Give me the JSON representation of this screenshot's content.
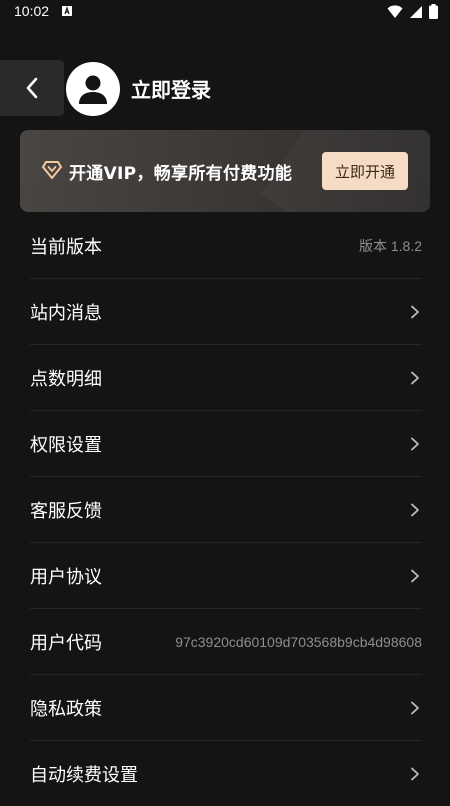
{
  "status_bar": {
    "time": "10:02",
    "icons": [
      "notification-a-icon",
      "wifi-icon",
      "signal-icon",
      "battery-icon"
    ]
  },
  "header": {
    "back_icon": "chevron-left-icon",
    "avatar_icon": "user-avatar-icon",
    "login_label": "立即登录"
  },
  "vip_banner": {
    "icon": "diamond-icon",
    "text": "开通VIP，畅享所有付费功能",
    "button_label": "立即开通",
    "button_color": "#f6dcc4"
  },
  "menu": {
    "items": [
      {
        "label": "当前版本",
        "value": "版本 1.8.2",
        "has_chevron": false
      },
      {
        "label": "站内消息",
        "value": "",
        "has_chevron": true
      },
      {
        "label": "点数明细",
        "value": "",
        "has_chevron": true
      },
      {
        "label": "权限设置",
        "value": "",
        "has_chevron": true
      },
      {
        "label": "客服反馈",
        "value": "",
        "has_chevron": true
      },
      {
        "label": "用户协议",
        "value": "",
        "has_chevron": true
      },
      {
        "label": "用户代码",
        "value": "97c3920cd60109d703568b9cb4d98608",
        "has_chevron": false
      },
      {
        "label": "隐私政策",
        "value": "",
        "has_chevron": true
      },
      {
        "label": "自动续费设置",
        "value": "",
        "has_chevron": true
      }
    ]
  },
  "colors": {
    "background": "#141414",
    "divider": "#262626",
    "secondary_text": "#8e8e8e"
  }
}
